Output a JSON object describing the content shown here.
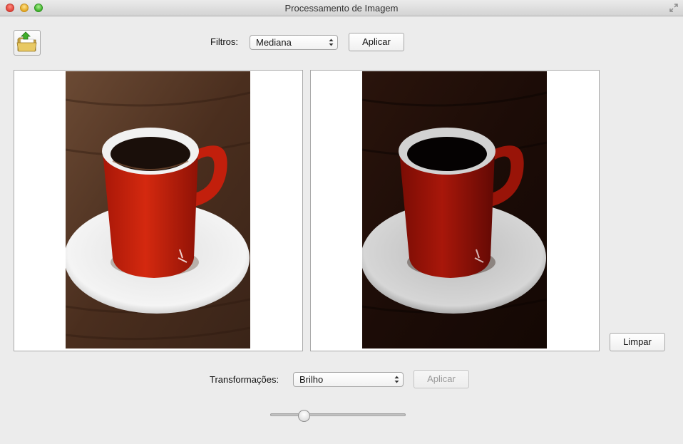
{
  "window": {
    "title": "Processamento de Imagem"
  },
  "toolbar": {
    "open_icon": "folder-open-icon",
    "filters_label": "Filtros:",
    "filters_selected": "Mediana",
    "apply_filter_label": "Aplicar"
  },
  "images": {
    "original_icon": "coffee-cup-photo",
    "processed_icon": "coffee-cup-photo-darkened"
  },
  "side": {
    "clear_label": "Limpar"
  },
  "bottom": {
    "transform_label": "Transformações:",
    "transform_selected": "Brilho",
    "apply_transform_label": "Aplicar",
    "apply_transform_enabled": false,
    "slider_value": 0.25
  },
  "colors": {
    "cup_red": "#c8200e",
    "wood_dark": "#3a2418",
    "window_bg": "#ececec"
  }
}
